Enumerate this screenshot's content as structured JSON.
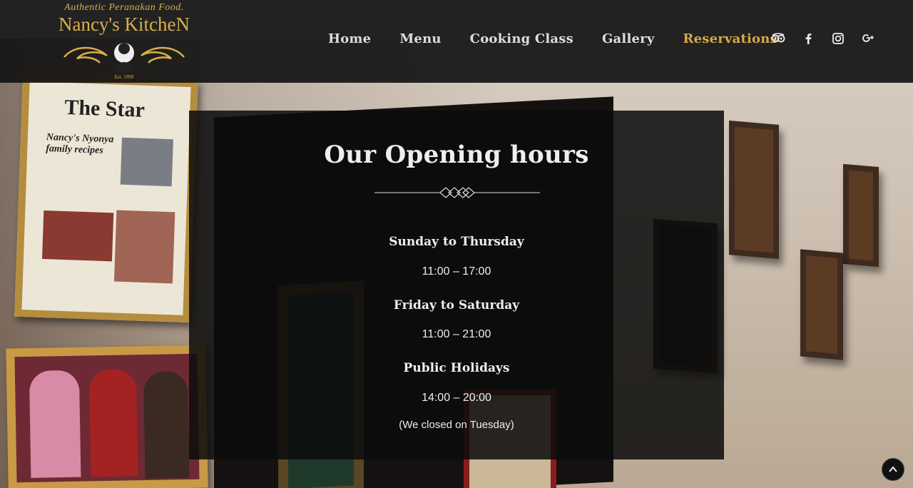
{
  "logo": {
    "tagline": "Authentic Peranakan Food.",
    "name": "Nancy's KitcheN",
    "established": "Est. 1999"
  },
  "nav": {
    "items": [
      {
        "label": "Home",
        "active": false
      },
      {
        "label": "Menu",
        "active": false
      },
      {
        "label": "Cooking Class",
        "active": false
      },
      {
        "label": "Gallery",
        "active": false
      },
      {
        "label": "Reservations",
        "active": true
      }
    ],
    "accent_color": "#d9a94a"
  },
  "socials": [
    {
      "icon": "tripadvisor-icon",
      "glyph": "◎"
    },
    {
      "icon": "facebook-icon",
      "glyph": "f"
    },
    {
      "icon": "instagram-icon",
      "glyph": "▣"
    },
    {
      "icon": "google-plus-icon",
      "glyph": "g+"
    }
  ],
  "background_photo": {
    "newspaper_title": "The Star",
    "newspaper_headline": "Nancy's Nyonya family recipes"
  },
  "hours": {
    "title": "Our Opening hours",
    "schedule": [
      {
        "days": "Sunday to Thursday",
        "time": "11:00 – 17:00"
      },
      {
        "days": "Friday to Saturday",
        "time": "11:00 – 21:00"
      },
      {
        "days": "Public Holidays",
        "time": "14:00 – 20:00"
      }
    ],
    "note": "(We closed on Tuesday)"
  },
  "back_to_top_icon": "chevron-up-icon"
}
